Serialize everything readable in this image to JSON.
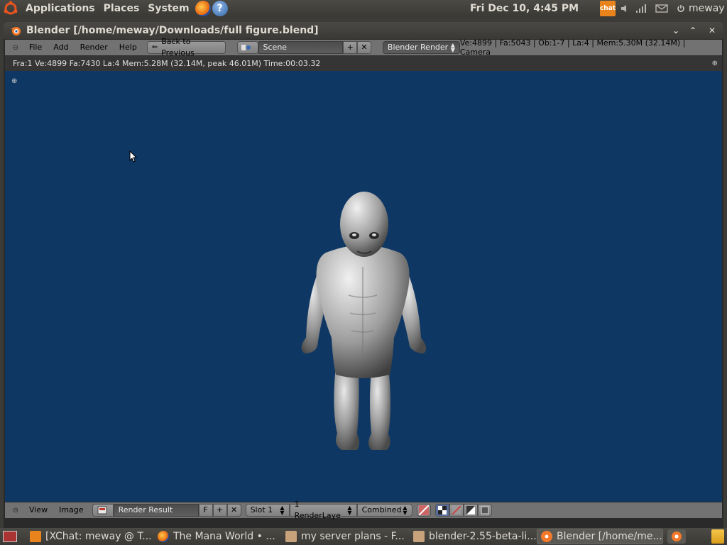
{
  "panel": {
    "menus": [
      "Applications",
      "Places",
      "System"
    ],
    "help_glyph": "?",
    "clock": "Fri Dec 10,  4:45 PM",
    "xchat_tray_label": "chat",
    "user": "meway"
  },
  "window": {
    "title": "Blender [/home/meway/Downloads/full figure.blend]",
    "minimize_glyph": "⌄",
    "maximize_glyph": "⌃",
    "close_glyph": "✕"
  },
  "header": {
    "menu_items": [
      "File",
      "Add",
      "Render",
      "Help"
    ],
    "back_button": "Back to Previous",
    "scene_name": "Scene",
    "render_engine": "Blender Render",
    "stats": "Ve:4899 | Fa:5043 | Ob:1-7 | La:4 | Mem:5.30M (32.14M) | Camera"
  },
  "render_stats": "Fra:1  Ve:4899 Fa:7430 La:4 Mem:5.28M (32.14M, peak 46.01M) Time:00:03.32",
  "footer": {
    "menu_items": [
      "View",
      "Image"
    ],
    "image_name": "Render Result",
    "fake_user": "F",
    "slot": "Slot 1",
    "render_layer": "1 RenderLaye",
    "pass": "Combined"
  },
  "taskbar": {
    "tasks": [
      "[XChat: meway @ T...",
      "The Mana World • ...",
      "my server plans - F...",
      "blender-2.55-beta-li...",
      "Blender [/home/me..."
    ]
  },
  "colors": {
    "viewport_bg": "#0e3764",
    "header_bg": "#727272",
    "panel_bg": "#3c3b37"
  },
  "icons": [
    "ubuntu-logo-icon",
    "firefox-icon",
    "help-icon",
    "xchat-icon",
    "volume-icon",
    "network-icon",
    "mail-icon",
    "power-icon",
    "blender-icon",
    "folder-icon",
    "trash-icon"
  ]
}
